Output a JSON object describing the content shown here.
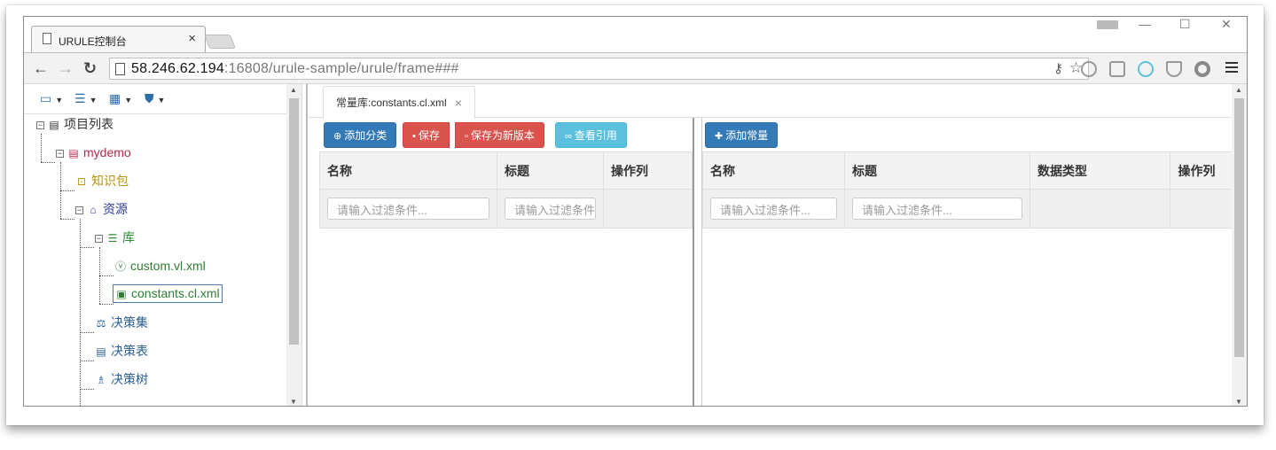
{
  "browser": {
    "tab_title": "URULE控制台",
    "tab_close": "×",
    "url_host": "58.246.62.194",
    "url_rest": ":16808/urule-sample/urule/frame###",
    "window_controls": [
      "—",
      "☐",
      "✕"
    ]
  },
  "left_toolbar": {
    "items": [
      {
        "icon": "monitor-icon"
      },
      {
        "icon": "list-icon"
      },
      {
        "icon": "grid-icon"
      },
      {
        "icon": "shield-icon"
      }
    ]
  },
  "tree": {
    "root": {
      "label": "项目列表",
      "icon": "list-icon"
    },
    "project": {
      "label": "mydemo",
      "icon": "folder-icon",
      "color": "#b5294a"
    },
    "knowledge": {
      "label": "知识包",
      "icon": "package-icon",
      "color": "#c7a21a"
    },
    "resources": {
      "label": "资源",
      "icon": "bank-icon",
      "color": "#2f3aa0"
    },
    "library": {
      "label": "库",
      "icon": "database-icon",
      "color": "#2e8b3a"
    },
    "custom": {
      "label": "custom.vl.xml",
      "icon": "variable-icon",
      "color": "#2e7d32"
    },
    "constants": {
      "label": "constants.cl.xml",
      "icon": "constant-icon",
      "color": "#2e7d32"
    },
    "decision_set": {
      "label": "决策集",
      "icon": "scale-icon",
      "color": "#2b5f8f"
    },
    "decision_table": {
      "label": "决策表",
      "icon": "table-icon",
      "color": "#2b5f8f"
    },
    "decision_tree": {
      "label": "决策树",
      "icon": "sitemap-icon",
      "color": "#2b5f8f"
    }
  },
  "editor": {
    "tab_label": "常量库:constants.cl.xml",
    "tab_close": "×"
  },
  "left_pane": {
    "buttons": {
      "add_category": "添加分类",
      "save": "保存",
      "save_new_version": "保存为新版本",
      "view_references": "查看引用"
    },
    "columns": [
      "名称",
      "标题",
      "操作列"
    ],
    "filter_placeholders": [
      "请输入过滤条件...",
      "请输入过滤条件..."
    ]
  },
  "right_pane": {
    "buttons": {
      "add_constant": "添加常量"
    },
    "columns": [
      "名称",
      "标题",
      "数据类型",
      "操作列"
    ],
    "filter_placeholders": [
      "请输入过滤条件...",
      "请输入过滤条件..."
    ]
  },
  "colors": {
    "primary": "#337ab7",
    "danger": "#d9534f",
    "info": "#5bc0de"
  }
}
